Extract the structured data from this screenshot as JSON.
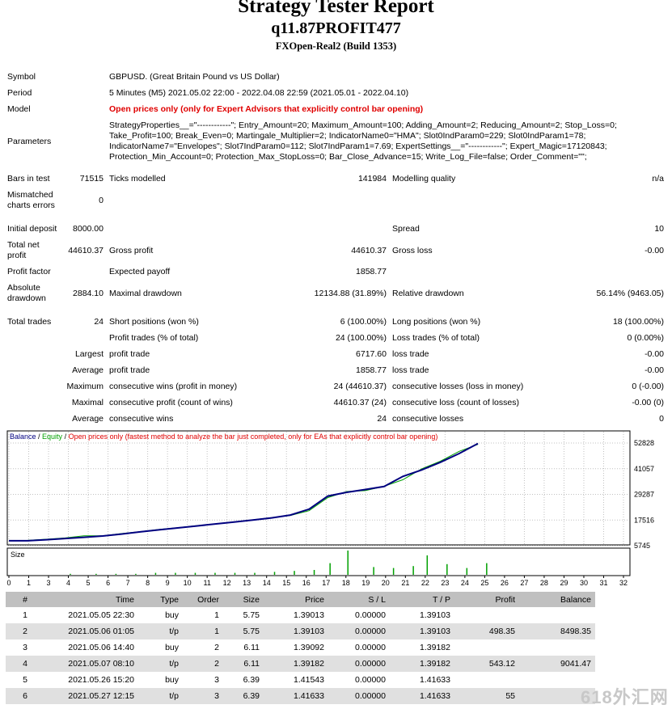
{
  "report": {
    "title": "Strategy Tester Report",
    "subtitle": "q11.87PROFIT477",
    "server": "FXOpen-Real2 (Build 1353)"
  },
  "summary": {
    "symbol_label": "Symbol",
    "symbol_value": "GBPUSD. (Great Britain Pound vs US Dollar)",
    "period_label": "Period",
    "period_value": "5 Minutes (M5) 2021.05.02 22:00 - 2022.04.08 22:59 (2021.05.01 - 2022.04.10)",
    "model_label": "Model",
    "model_value": "Open prices only (only for Expert Advisors that explicitly control bar opening)",
    "parameters_label": "Parameters",
    "parameters_value": "StrategyProperties__=\"------------\"; Entry_Amount=20; Maximum_Amount=100; Adding_Amount=2; Reducing_Amount=2; Stop_Loss=0; Take_Profit=100; Break_Even=0; Martingale_Multiplier=2; IndicatorName0=\"HMA\"; Slot0IndParam0=229; Slot0IndParam1=78; IndicatorName7=\"Envelopes\"; Slot7IndParam0=112; Slot7IndParam1=7.69; ExpertSettings__=\"------------\"; Expert_Magic=17120843; Protection_Min_Account=0; Protection_Max_StopLoss=0; Bar_Close_Advance=15; Write_Log_File=false; Order_Comment=\"\";"
  },
  "stats": {
    "bars_in_test_label": "Bars in test",
    "bars_in_test": "71515",
    "ticks_modelled_label": "Ticks modelled",
    "ticks_modelled": "141984",
    "modelling_quality_label": "Modelling quality",
    "modelling_quality": "n/a",
    "mismatched_label": "Mismatched charts errors",
    "mismatched": "0",
    "initial_deposit_label": "Initial deposit",
    "initial_deposit": "8000.00",
    "spread_label": "Spread",
    "spread": "10",
    "total_net_profit_label": "Total net profit",
    "total_net_profit": "44610.37",
    "gross_profit_label": "Gross profit",
    "gross_profit": "44610.37",
    "gross_loss_label": "Gross loss",
    "gross_loss": "-0.00",
    "profit_factor_label": "Profit factor",
    "expected_payoff_label": "Expected payoff",
    "expected_payoff": "1858.77",
    "absolute_drawdown_label": "Absolute drawdown",
    "absolute_drawdown": "2884.10",
    "maximal_drawdown_label": "Maximal drawdown",
    "maximal_drawdown": "12134.88 (31.89%)",
    "relative_drawdown_label": "Relative drawdown",
    "relative_drawdown": "56.14% (9463.05)",
    "total_trades_label": "Total trades",
    "total_trades": "24",
    "short_positions_label": "Short positions (won %)",
    "short_positions": "6 (100.00%)",
    "long_positions_label": "Long positions (won %)",
    "long_positions": "18 (100.00%)",
    "profit_trades_label": "Profit trades (% of total)",
    "profit_trades": "24 (100.00%)",
    "loss_trades_label": "Loss trades (% of total)",
    "loss_trades": "0 (0.00%)",
    "largest_label": "Largest",
    "largest_profit_label": "profit trade",
    "largest_profit": "6717.60",
    "largest_loss_label": "loss trade",
    "largest_loss": "-0.00",
    "average_label": "Average",
    "average_profit_label": "profit trade",
    "average_profit": "1858.77",
    "average_loss_label": "loss trade",
    "average_loss": "-0.00",
    "maximum_label": "Maximum",
    "max_cons_wins_label": "consecutive wins (profit in money)",
    "max_cons_wins": "24 (44610.37)",
    "max_cons_losses_label": "consecutive losses (loss in money)",
    "max_cons_losses": "0 (-0.00)",
    "maximal_label": "Maximal",
    "maximal_cons_profit_label": "consecutive profit (count of wins)",
    "maximal_cons_profit": "44610.37 (24)",
    "maximal_cons_loss_label": "consecutive loss (count of losses)",
    "maximal_cons_loss": "-0.00 (0)",
    "average2_label": "Average",
    "avg_cons_wins_label": "consecutive wins",
    "avg_cons_wins": "24",
    "avg_cons_losses_label": "consecutive losses",
    "avg_cons_losses": "0"
  },
  "chart_data": {
    "type": "line",
    "legend": {
      "balance": "Balance",
      "sep1": " / ",
      "equity": "Equity",
      "sep2": " / ",
      "note": "Open prices only (fastest method to analyze the bar just completed, only for EAs that explicitly control bar opening)"
    },
    "colors": {
      "balance": "#000080",
      "equity": "#00a000",
      "note": "#e00000",
      "size": "#00a000",
      "grid": "#c0c0c0"
    },
    "y_ticks": [
      "52828",
      "41057",
      "29287",
      "17516",
      "5745"
    ],
    "ylim": [
      5745,
      52828
    ],
    "x_ticks": [
      "0",
      "1",
      "3",
      "4",
      "5",
      "6",
      "7",
      "8",
      "9",
      "10",
      "11",
      "12",
      "13",
      "14",
      "15",
      "16",
      "17",
      "18",
      "19",
      "20",
      "21",
      "22",
      "23",
      "24",
      "25",
      "26",
      "27",
      "28",
      "29",
      "30",
      "31",
      "32"
    ],
    "size_label": "Size",
    "balance": [
      [
        0,
        8000
      ],
      [
        1,
        8000
      ],
      [
        2,
        8498
      ],
      [
        3,
        9041
      ],
      [
        4,
        9600
      ],
      [
        5,
        10200
      ],
      [
        6,
        11100
      ],
      [
        7,
        12100
      ],
      [
        8,
        13000
      ],
      [
        9,
        13900
      ],
      [
        10,
        14800
      ],
      [
        11,
        15700
      ],
      [
        12,
        16600
      ],
      [
        13,
        17500
      ],
      [
        14,
        18500
      ],
      [
        15,
        19800
      ],
      [
        16,
        22500
      ],
      [
        17,
        28500
      ],
      [
        18,
        30200
      ],
      [
        19,
        31500
      ],
      [
        20,
        32900
      ],
      [
        21,
        37500
      ],
      [
        22,
        40500
      ],
      [
        23,
        44000
      ],
      [
        24,
        48000
      ],
      [
        25,
        52610
      ]
    ],
    "equity": [
      [
        0,
        8000
      ],
      [
        1,
        8200
      ],
      [
        2,
        8700
      ],
      [
        3,
        9300
      ],
      [
        4,
        10300
      ],
      [
        5,
        10300
      ],
      [
        6,
        11300
      ],
      [
        7,
        12200
      ],
      [
        8,
        13200
      ],
      [
        9,
        14000
      ],
      [
        10,
        14900
      ],
      [
        11,
        15700
      ],
      [
        12,
        16700
      ],
      [
        13,
        17600
      ],
      [
        14,
        18600
      ],
      [
        15,
        19600
      ],
      [
        16,
        21800
      ],
      [
        17,
        27800
      ],
      [
        18,
        30600
      ],
      [
        19,
        31000
      ],
      [
        20,
        33000
      ],
      [
        21,
        36000
      ],
      [
        22,
        41000
      ],
      [
        23,
        44500
      ],
      [
        24,
        49000
      ],
      [
        25,
        52200
      ]
    ],
    "sizes": [
      [
        3.1,
        1
      ],
      [
        4.4,
        1
      ],
      [
        5.4,
        1
      ],
      [
        6.4,
        1
      ],
      [
        7.4,
        2
      ],
      [
        8.4,
        2
      ],
      [
        9.4,
        2
      ],
      [
        10.4,
        2
      ],
      [
        11.4,
        2
      ],
      [
        12.4,
        2
      ],
      [
        13.4,
        3
      ],
      [
        14.4,
        4
      ],
      [
        15.4,
        5
      ],
      [
        16.2,
        12
      ],
      [
        17.1,
        25
      ],
      [
        18.4,
        8
      ],
      [
        19.4,
        7
      ],
      [
        20.4,
        9
      ],
      [
        21.1,
        20
      ],
      [
        22.1,
        11
      ],
      [
        23.1,
        7
      ],
      [
        24.1,
        12
      ]
    ]
  },
  "trades": {
    "headers": [
      "#",
      "Time",
      "Type",
      "Order",
      "Size",
      "Price",
      "S / L",
      "T / P",
      "Profit",
      "Balance"
    ],
    "rows": [
      [
        "1",
        "2021.05.05 22:30",
        "buy",
        "1",
        "5.75",
        "1.39013",
        "0.00000",
        "1.39103",
        "",
        ""
      ],
      [
        "2",
        "2021.05.06 01:05",
        "t/p",
        "1",
        "5.75",
        "1.39103",
        "0.00000",
        "1.39103",
        "498.35",
        "8498.35"
      ],
      [
        "3",
        "2021.05.06 14:40",
        "buy",
        "2",
        "6.11",
        "1.39092",
        "0.00000",
        "1.39182",
        "",
        ""
      ],
      [
        "4",
        "2021.05.07 08:10",
        "t/p",
        "2",
        "6.11",
        "1.39182",
        "0.00000",
        "1.39182",
        "543.12",
        "9041.47"
      ],
      [
        "5",
        "2021.05.26 15:20",
        "buy",
        "3",
        "6.39",
        "1.41543",
        "0.00000",
        "1.41633",
        "",
        ""
      ],
      [
        "6",
        "2021.05.27 12:15",
        "t/p",
        "3",
        "6.39",
        "1.41633",
        "0.00000",
        "1.41633",
        "55",
        ""
      ]
    ]
  },
  "watermark": "618外汇网"
}
